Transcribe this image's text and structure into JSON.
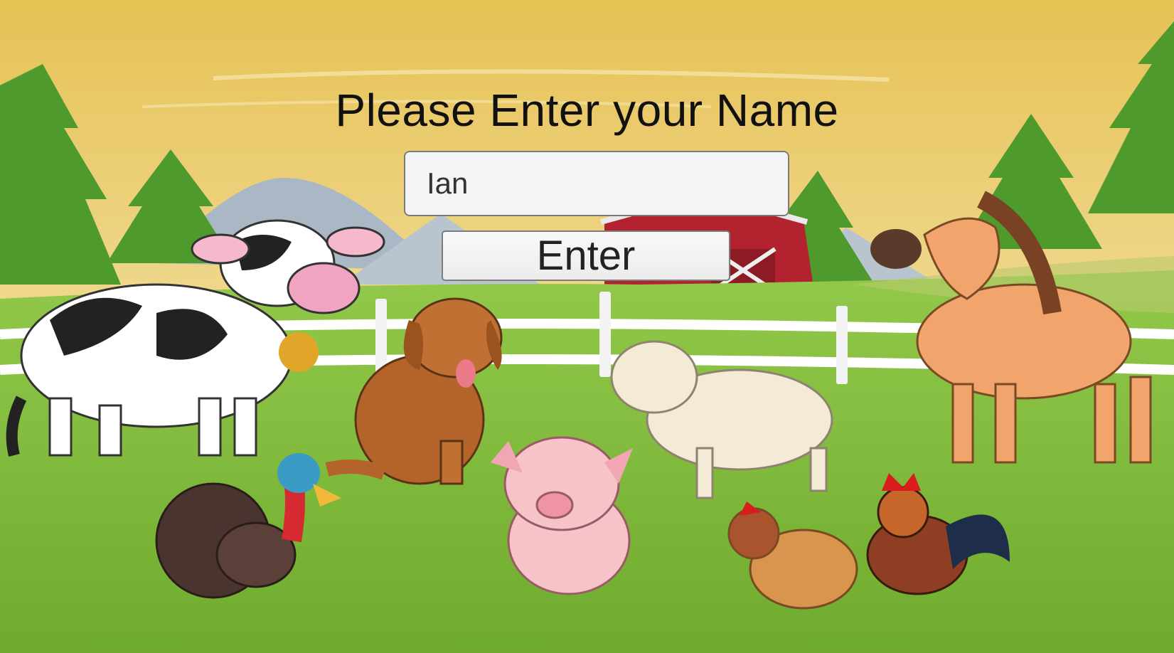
{
  "prompt": {
    "title": "Please Enter your Name"
  },
  "name_field": {
    "value": "Ian"
  },
  "enter_button": {
    "label": "Enter"
  },
  "colors": {
    "sky_top": "#e8c55a",
    "sky_bottom": "#f3e3a6",
    "grass": "#7fb83a",
    "barn": "#b3232f"
  },
  "scene": {
    "background": "farm-background",
    "animals": [
      "cow",
      "dog",
      "sheep",
      "horse",
      "pig",
      "turkey",
      "hen",
      "rooster"
    ]
  }
}
